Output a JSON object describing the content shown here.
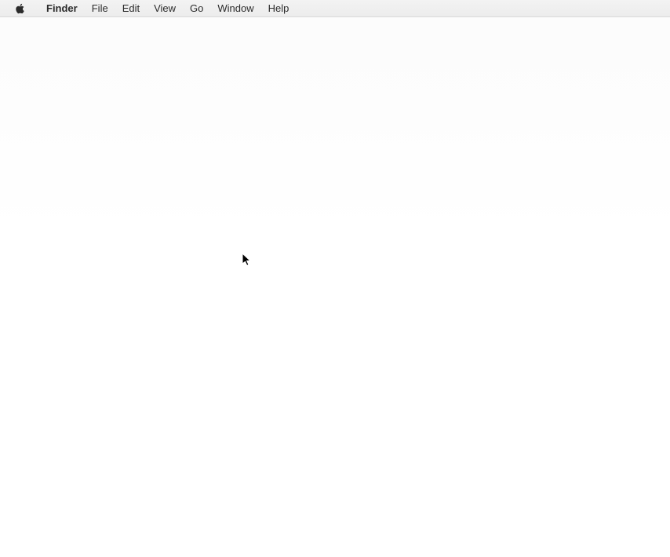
{
  "menubar": {
    "app_name": "Finder",
    "items": [
      {
        "label": "File"
      },
      {
        "label": "Edit"
      },
      {
        "label": "View"
      },
      {
        "label": "Go"
      },
      {
        "label": "Window"
      },
      {
        "label": "Help"
      }
    ]
  }
}
